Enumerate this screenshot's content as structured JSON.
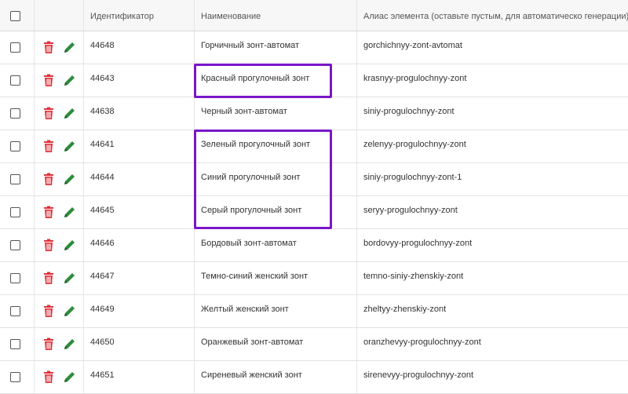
{
  "table": {
    "headers": {
      "select_all": "",
      "actions": "",
      "id": "Идентификатор",
      "name": "Наименование",
      "alias": "Алиас элемента (оставьте пустым, для автоматическо генерации)"
    },
    "rows": [
      {
        "id": "44648",
        "name": "Горчичный зонт-автомат",
        "alias": "gorchichnyy-zont-avtomat"
      },
      {
        "id": "44643",
        "name": "Красный прогулочный зонт",
        "alias": "krasnyy-progulochnyy-zont"
      },
      {
        "id": "44638",
        "name": "Черный зонт-автомат",
        "alias": "siniy-progulochnyy-zont"
      },
      {
        "id": "44641",
        "name": "Зеленый прогулочный зонт",
        "alias": "zelenyy-progulochnyy-zont"
      },
      {
        "id": "44644",
        "name": "Синий прогулочный зонт",
        "alias": "siniy-progulochnyy-zont-1"
      },
      {
        "id": "44645",
        "name": "Серый прогулочный зонт",
        "alias": "seryy-progulochnyy-zont"
      },
      {
        "id": "44646",
        "name": "Бордовый зонт-автомат",
        "alias": "bordovyy-progulochnyy-zont"
      },
      {
        "id": "44647",
        "name": "Темно-синий женский зонт",
        "alias": "temno-siniy-zhenskiy-zont"
      },
      {
        "id": "44649",
        "name": "Желтый женский зонт",
        "alias": "zheltyy-zhenskiy-zont"
      },
      {
        "id": "44650",
        "name": "Оранжевый зонт-автомат",
        "alias": "oranzhevyy-progulochnyy-zont"
      },
      {
        "id": "44651",
        "name": "Сиреневый женский зонт",
        "alias": "sirenevyy-progulochnyy-zont"
      }
    ]
  },
  "icons": {
    "delete": "trash-icon",
    "edit": "pencil-icon"
  },
  "colors": {
    "delete_icon": "#e0303a",
    "edit_icon": "#2e8b3d",
    "highlight": "#7a16c9"
  }
}
